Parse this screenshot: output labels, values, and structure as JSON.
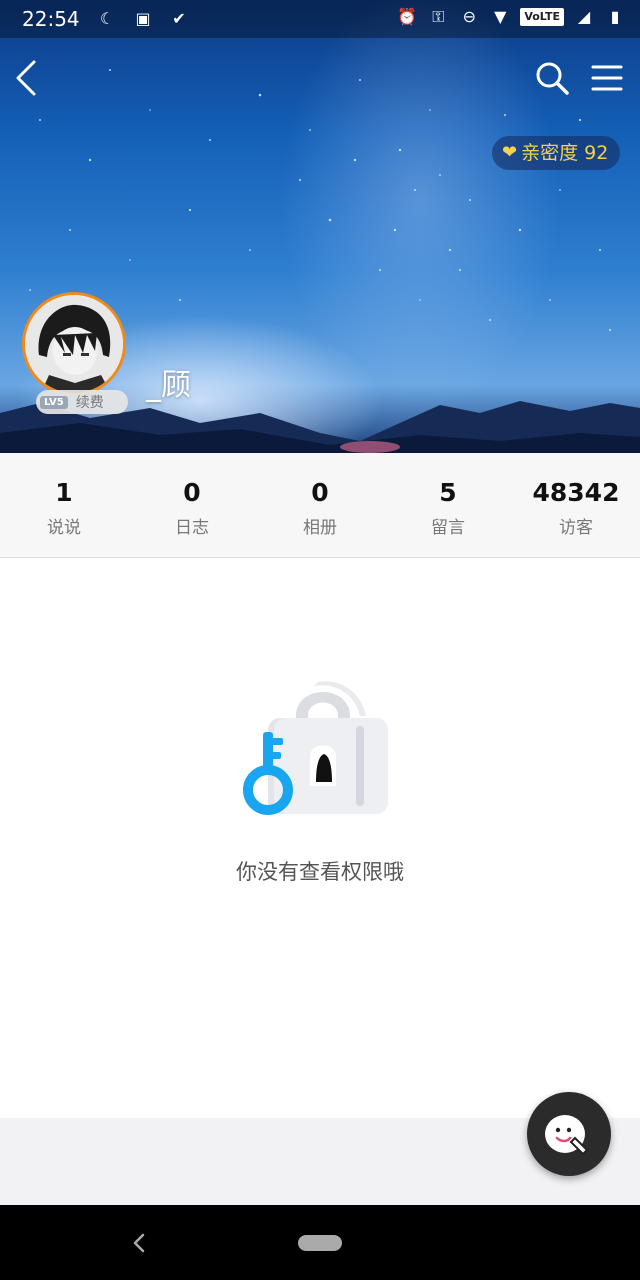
{
  "status_bar": {
    "time": "22:54",
    "volte_label": "VoLTE",
    "left_icons": [
      "moon-icon",
      "sim-toolkit-icon",
      "check-icon"
    ],
    "right_icons": [
      "alarm-icon",
      "vpn-key-icon",
      "do-not-disturb-icon",
      "wifi-icon",
      "volte-icon",
      "signal-icon",
      "battery-icon"
    ]
  },
  "header": {
    "back_icon": "back-chevron-icon",
    "search_icon": "search-icon",
    "menu_icon": "menu-icon",
    "intimacy_label": "亲密度 92",
    "username": "_顾",
    "level_tag": "LV5",
    "renew_label": "续费",
    "colors": {
      "intimacy_text": "#f7d24a",
      "avatar_ring": "#f08a1a"
    }
  },
  "stats": [
    {
      "value": "1",
      "label": "说说"
    },
    {
      "value": "0",
      "label": "日志"
    },
    {
      "value": "0",
      "label": "相册"
    },
    {
      "value": "5",
      "label": "留言"
    },
    {
      "value": "48342",
      "label": "访客"
    }
  ],
  "content": {
    "lock_icon": "lock-with-key-icon",
    "message": "你没有查看权限哦",
    "accent": "#19a6f0"
  },
  "floating_button": {
    "icon": "qq-penguin-icon"
  },
  "system_nav": {
    "back_icon": "back-triangle-icon",
    "home_icon": "home-pill-icon"
  }
}
